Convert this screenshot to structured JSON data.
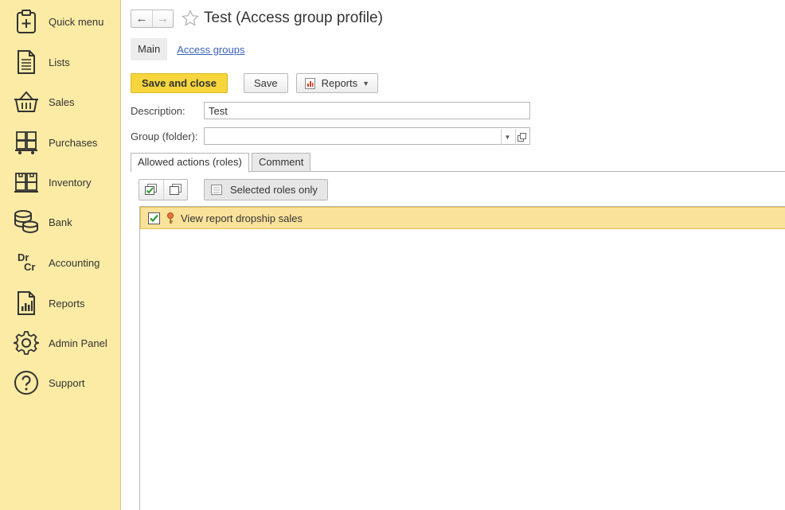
{
  "sidebar": {
    "items": [
      {
        "label": "Quick menu",
        "icon": "quick-menu-icon"
      },
      {
        "label": "Lists",
        "icon": "lists-icon"
      },
      {
        "label": "Sales",
        "icon": "sales-basket-icon"
      },
      {
        "label": "Purchases",
        "icon": "purchases-cart-icon"
      },
      {
        "label": "Inventory",
        "icon": "inventory-boxes-icon"
      },
      {
        "label": "Bank",
        "icon": "bank-coins-icon"
      },
      {
        "label": "Accounting",
        "icon": "accounting-drcr-icon"
      },
      {
        "label": "Reports",
        "icon": "reports-chart-icon"
      },
      {
        "label": "Admin Panel",
        "icon": "admin-gear-icon"
      },
      {
        "label": "Support",
        "icon": "support-question-icon"
      }
    ],
    "accounting_icon_top": "Dr",
    "accounting_icon_bottom": "Cr"
  },
  "header": {
    "back_glyph": "←",
    "forward_glyph": "→",
    "title": "Test (Access group profile)"
  },
  "form_tabs": {
    "main_label": "Main",
    "access_groups_label": "Access groups"
  },
  "toolbar": {
    "save_close_label": "Save and close",
    "save_label": "Save",
    "reports_label": "Reports"
  },
  "fields": {
    "description_label": "Description:",
    "description_value": "Test",
    "group_label": "Group (folder):",
    "group_value": ""
  },
  "inner_tabs": {
    "roles_label": "Allowed actions (roles)",
    "comment_label": "Comment"
  },
  "roles_toolbar": {
    "selected_only_label": "Selected roles only"
  },
  "roles": [
    {
      "label": "View report dropship sales",
      "checked": true
    }
  ],
  "colors": {
    "sidebar_bg": "#fbeba5",
    "primary_button": "#f6d63c",
    "selected_row": "#fbe29b",
    "link": "#3b63b9"
  }
}
